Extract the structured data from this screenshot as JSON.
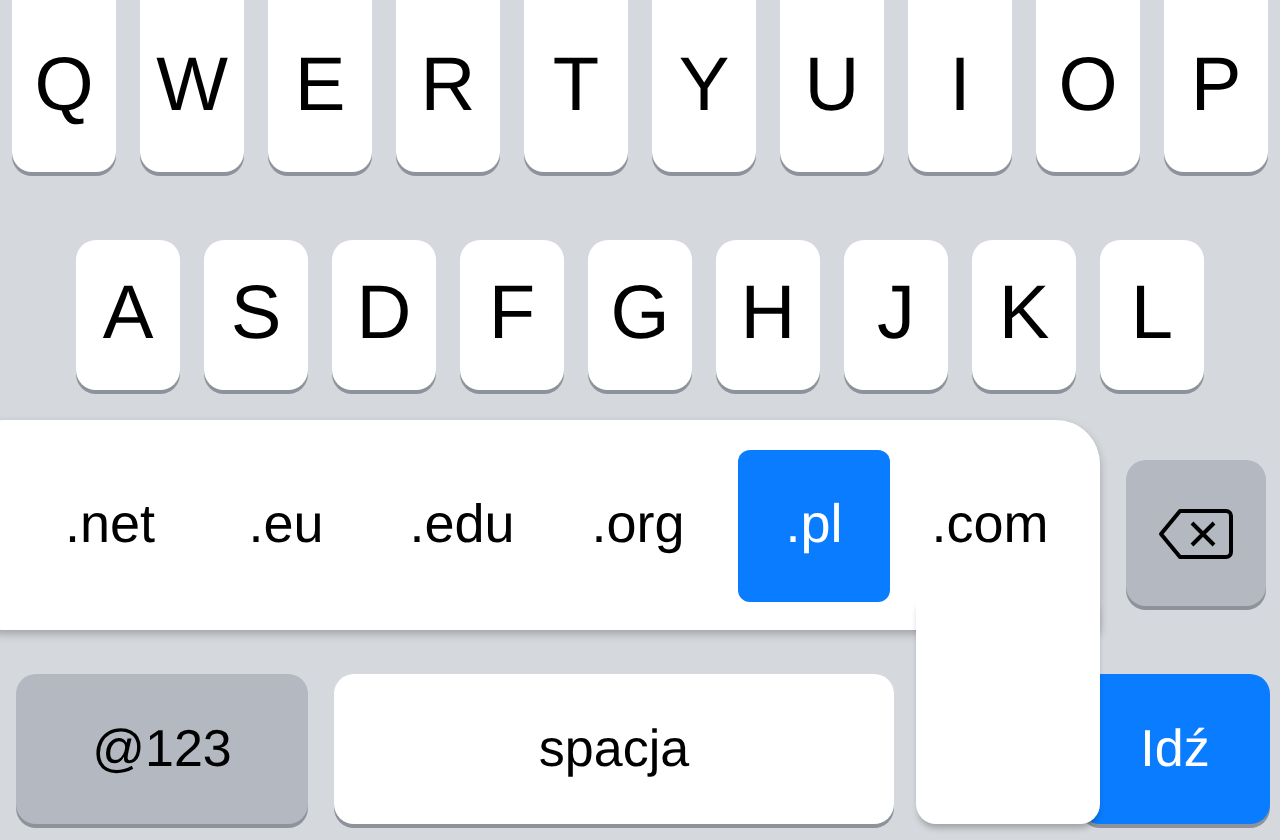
{
  "rows": [
    [
      "Q",
      "W",
      "E",
      "R",
      "T",
      "Y",
      "U",
      "I",
      "O",
      "P"
    ],
    [
      "A",
      "S",
      "D",
      "F",
      "G",
      "H",
      "J",
      "K",
      "L"
    ]
  ],
  "domain_popup": {
    "items": [
      {
        "label": ".net",
        "selected": false
      },
      {
        "label": ".eu",
        "selected": false
      },
      {
        "label": ".edu",
        "selected": false
      },
      {
        "label": ".org",
        "selected": false
      },
      {
        "label": ".pl",
        "selected": true
      },
      {
        "label": ".com",
        "selected": false
      }
    ]
  },
  "bottom_row": [
    {
      "kind": "mode",
      "label": "@123"
    },
    {
      "kind": "space",
      "label": "spacja"
    },
    {
      "kind": "go",
      "label": "Idź"
    }
  ]
}
